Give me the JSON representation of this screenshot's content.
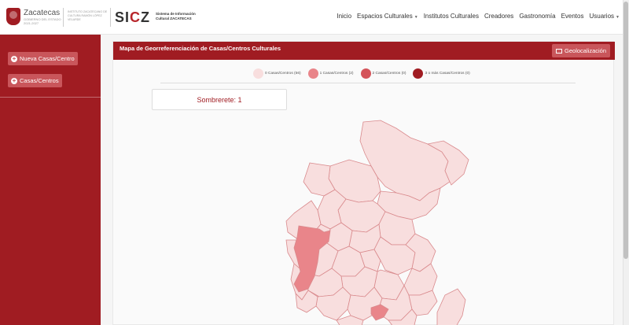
{
  "brand": {
    "gov_name": "Zacatecas",
    "gov_subtitle": "GOBIERNO DEL ESTADO 2021-2027",
    "secretaria": "INSTITUTO ZACATECANO DE CULTURA RAMÓN LÓPEZ VELARDE",
    "sicz_logo_pre": "SI",
    "sicz_logo_accent": "C",
    "sicz_logo_post": "Z",
    "sicz_title": "Sistema de Información Cultural ZACATECAS"
  },
  "nav": {
    "items": [
      "Inicio",
      "Espacios Culturales",
      "Institutos Culturales",
      "Creadores",
      "Gastronomía",
      "Eventos",
      "Usuarios"
    ]
  },
  "sidebar": {
    "buttons": [
      "Nueva Casas/Centro",
      "Casas/Centros"
    ]
  },
  "card": {
    "title": "Mapa de Georreferenciación de Casas/Centros Culturales",
    "geo_button": "Geolocalización"
  },
  "legend": [
    {
      "label": "0 Casas/Centros (56)",
      "color": "#f8dede"
    },
    {
      "label": "1 Casas/Centros (2)",
      "color": "#e9858a"
    },
    {
      "label": "2 Casas/Centros (0)",
      "color": "#d4545a"
    },
    {
      "label": "3 o más Casas/Centros (0)",
      "color": "#a01c22"
    }
  ],
  "info": {
    "text": "Sombrerete: 1"
  },
  "colors": {
    "primary": "#a01c22",
    "button": "#c9565b",
    "map_base": "#f8dede",
    "map_highlight": "#e9858a"
  }
}
